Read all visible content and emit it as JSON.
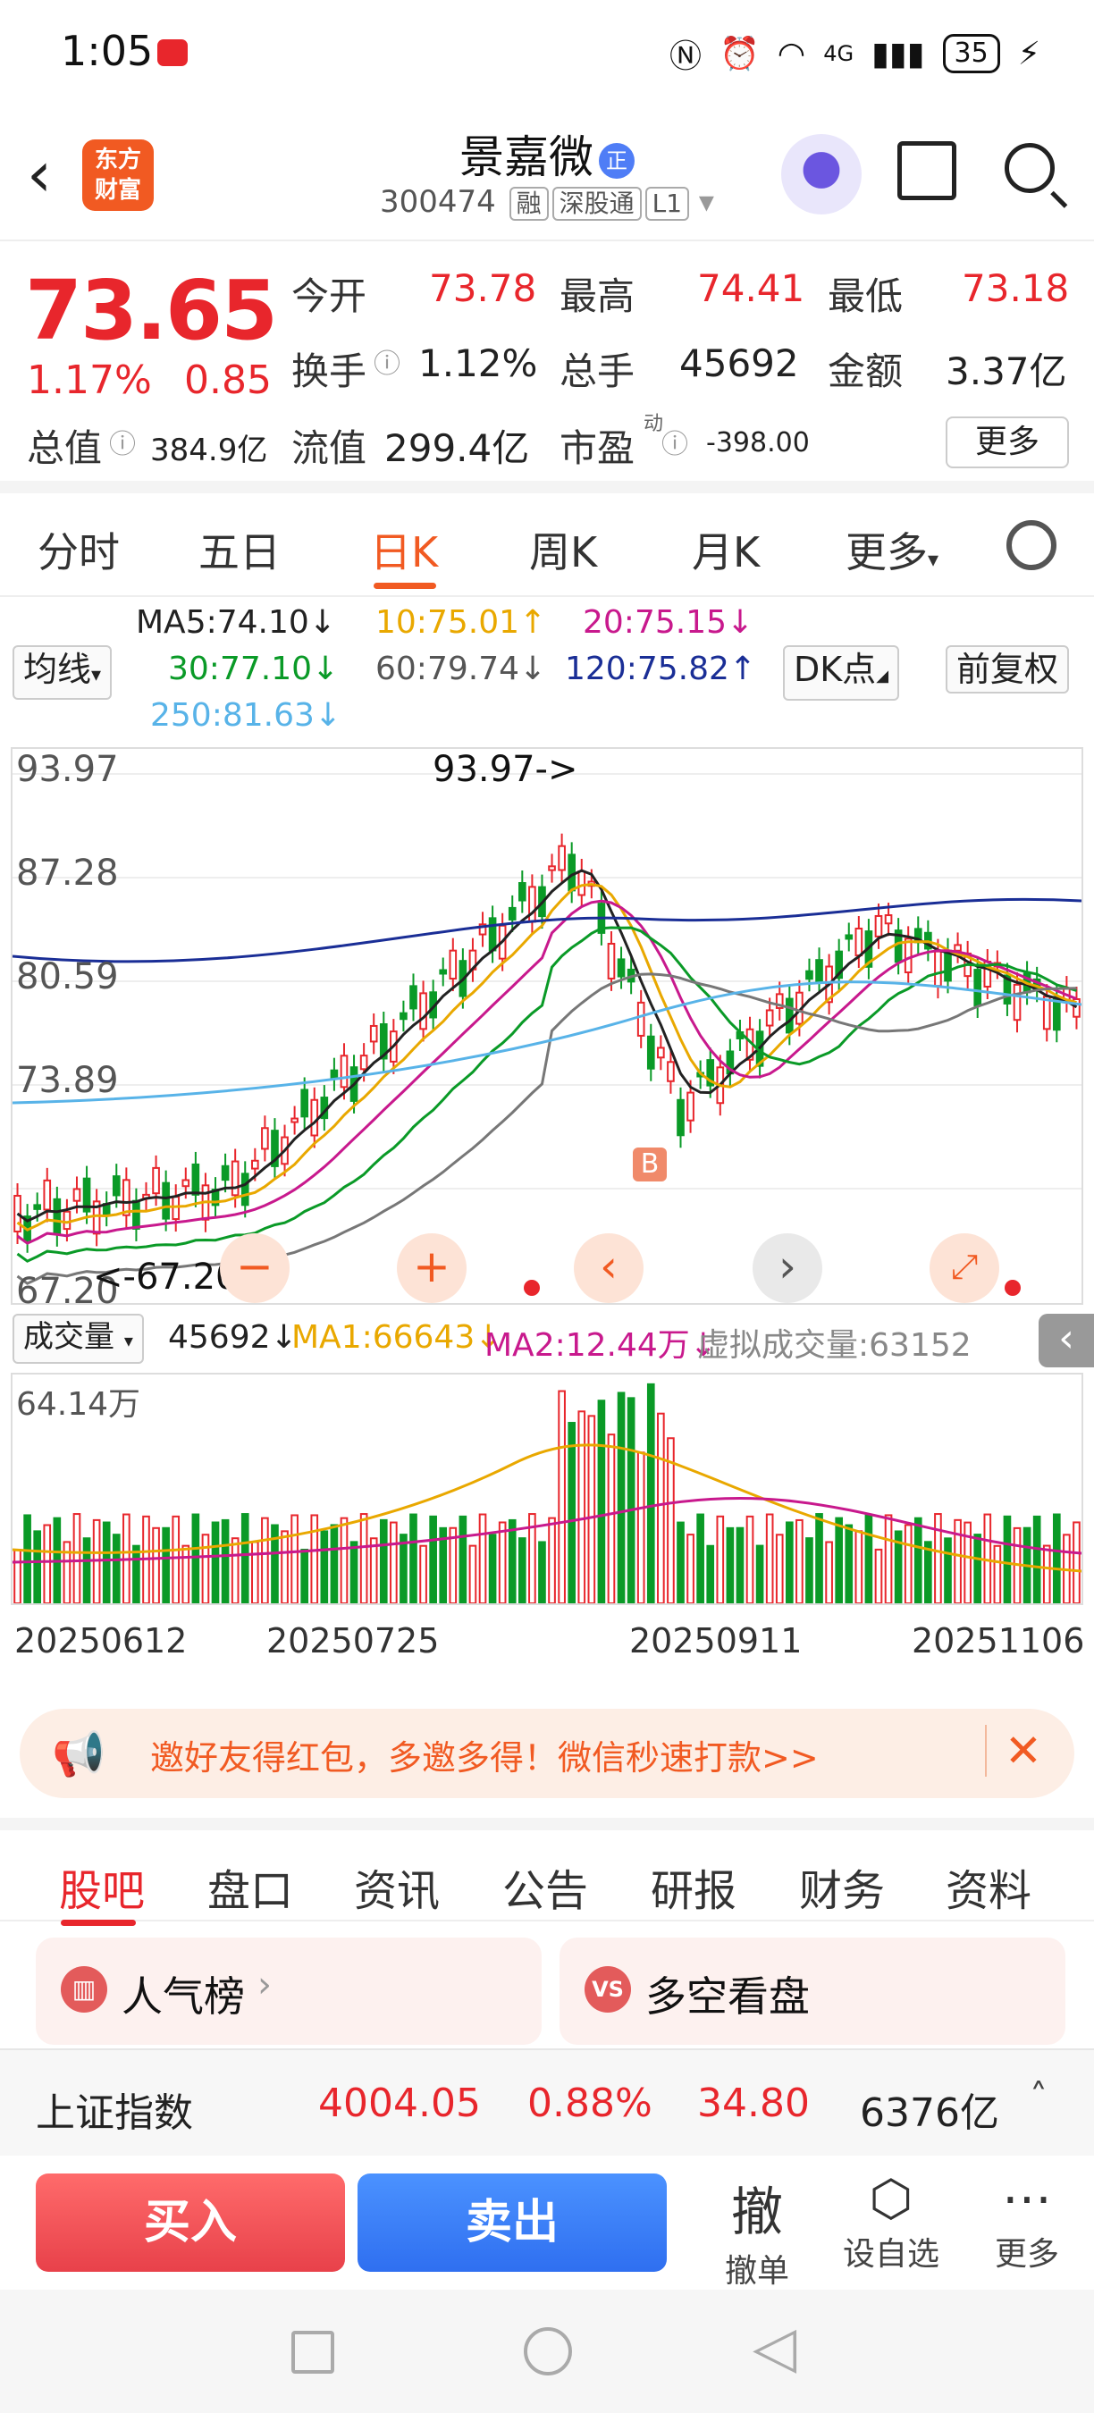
{
  "status": {
    "time": "1:05",
    "signal": "4G",
    "battery": "35"
  },
  "header": {
    "stock_name": "景嘉微",
    "name_badge": "正",
    "code": "300474",
    "tags": [
      "融",
      "深股通",
      "L1"
    ],
    "logo_text": [
      "东方",
      "财富"
    ]
  },
  "quote": {
    "price": "73.65",
    "change_pct": "1.17%",
    "change": "0.85",
    "fields": [
      {
        "label": "今开",
        "value": "73.78"
      },
      {
        "label": "最高",
        "value": "74.41"
      },
      {
        "label": "最低",
        "value": "73.18"
      },
      {
        "label": "换手",
        "value": "1.12%"
      },
      {
        "label": "总手",
        "value": "45692"
      },
      {
        "label": "金额",
        "value": "3.37亿"
      },
      {
        "label": "总值",
        "value": "384.9亿"
      },
      {
        "label": "流值",
        "value": "299.4亿"
      },
      {
        "label": "市盈",
        "value": "-398.00"
      }
    ],
    "pe_superscript": "动",
    "more_label": "更多"
  },
  "kline_tabs": [
    "分时",
    "五日",
    "日K",
    "周K",
    "月K",
    "更多"
  ],
  "ma_legend": {
    "selector": "均线",
    "ma5": "MA5:74.10↓",
    "ma10": "10:75.01↑",
    "ma20": "20:75.15↓",
    "ma30": "30:77.10↓",
    "ma60": "60:79.74↓",
    "ma120": "120:75.82↑",
    "ma250": "250:81.63↓",
    "dk": "DK点",
    "adjust": "前复权"
  },
  "chart": {
    "y_labels": [
      "93.97",
      "87.28",
      "80.59",
      "73.89",
      "67.20"
    ],
    "high_annotation": "93.97->",
    "low_annotation": "<-67.20",
    "marker": "B",
    "colors": {
      "up": "#e8262c",
      "down": "#0a9a27"
    }
  },
  "volume": {
    "selector": "成交量",
    "current": "45692↓",
    "ma1": "MA1:66643↓",
    "ma2": "MA2:12.44万↓",
    "virtual": "虚拟成交量:63152",
    "y_label": "64.14万"
  },
  "x_axis": [
    "20250612",
    "20250725",
    "20250911",
    "20251106"
  ],
  "banner": {
    "text": "邀好友得红包，多邀多得！微信秒速打款>>"
  },
  "bottom_tabs": [
    "股吧",
    "盘口",
    "资讯",
    "公告",
    "研报",
    "财务",
    "资料"
  ],
  "cards": [
    {
      "title": "人气榜",
      "icon": "chart-icon"
    },
    {
      "title": "多空看盘",
      "icon": "vs-icon"
    }
  ],
  "index_bar": {
    "name": "上证指数",
    "value": "4004.05",
    "pct": "0.88%",
    "change": "34.80",
    "amount": "6376亿"
  },
  "trade": {
    "buy": "买入",
    "sell": "卖出",
    "tools": [
      {
        "glyph": "撤",
        "label": "撤单"
      },
      {
        "label": "设自选"
      },
      {
        "label": "更多"
      }
    ]
  }
}
